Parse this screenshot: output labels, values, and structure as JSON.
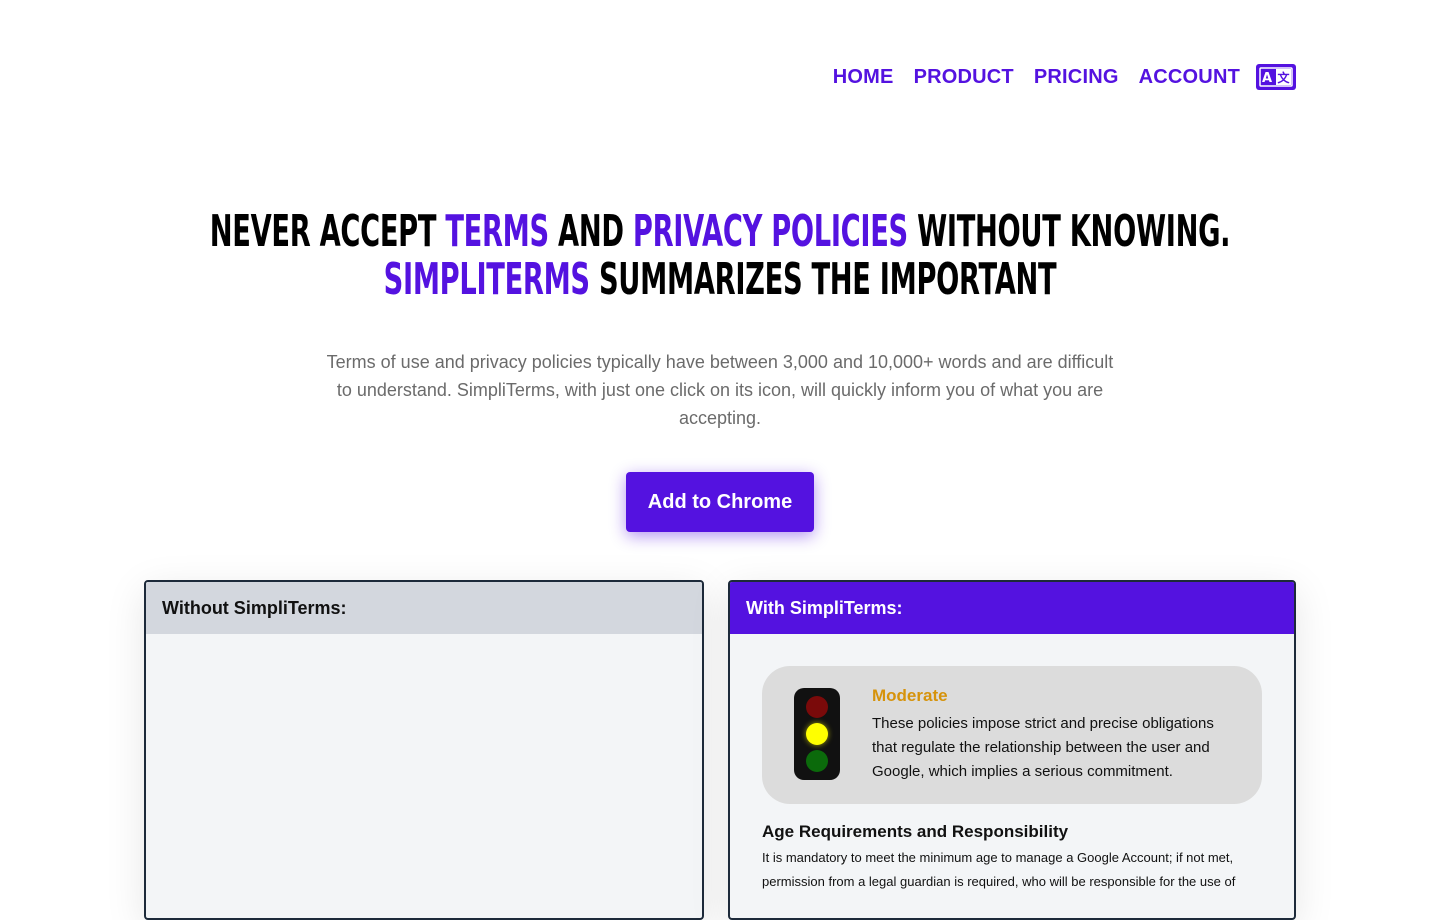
{
  "nav": {
    "items": [
      {
        "label": "HOME"
      },
      {
        "label": "PRODUCT"
      },
      {
        "label": "PRICING"
      },
      {
        "label": "ACCOUNT"
      }
    ],
    "language_icon": "translate-icon"
  },
  "hero": {
    "title_parts": [
      {
        "text": "Never accept ",
        "highlight": false
      },
      {
        "text": "Terms",
        "highlight": true
      },
      {
        "text": " and ",
        "highlight": false
      },
      {
        "text": "Privacy Policies",
        "highlight": true
      },
      {
        "text": " without knowing. ",
        "highlight": false
      },
      {
        "text": "SimpliTerms",
        "highlight": true
      },
      {
        "text": " summarizes the important",
        "highlight": false
      }
    ],
    "subtitle": "Terms of use and privacy policies typically have between 3,000 and 10,000+ words and are difficult to understand. SimpliTerms, with just one click on its icon, will quickly inform you of what you are accepting.",
    "cta_label": "Add to Chrome"
  },
  "panels": {
    "without": {
      "title": "Without SimpliTerms:"
    },
    "with": {
      "title": "With SimpliTerms:",
      "rating": {
        "label": "Moderate",
        "description": "These policies impose strict and precise obligations that regulate the relationship between the user and Google, which implies a serious commitment."
      },
      "section": {
        "title": "Age Requirements and Responsibility",
        "text": "It is mandatory to meet the minimum age to manage a Google Account; if not met, permission from a legal guardian is required, who will be responsible for the use of"
      }
    }
  },
  "colors": {
    "accent": "#5412e0",
    "moderate": "#d6930b",
    "without_header": "#d3d7de",
    "panel_bg": "#f3f5f7"
  }
}
